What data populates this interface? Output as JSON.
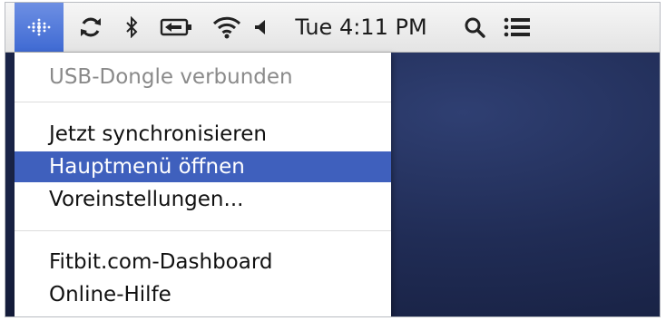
{
  "menubar": {
    "icons": [
      "fitbit-icon",
      "sync-icon",
      "bluetooth-icon",
      "battery-icon",
      "wifi-icon",
      "volume-icon",
      "search-icon",
      "list-icon"
    ],
    "clock": "Tue 4:11 PM"
  },
  "menu": {
    "status": "USB-Dongle verbunden",
    "sync": "Jetzt synchronisieren",
    "main_menu": "Hauptmenü öffnen",
    "preferences": "Voreinstellungen...",
    "dashboard": "Fitbit.com-Dashboard",
    "help": "Online-Hilfe"
  },
  "colors": {
    "menubar": "#e8e8e8",
    "selection": "#3f60bd",
    "fitbit_highlight": "#4f79dc",
    "desktop": "#202c55"
  }
}
